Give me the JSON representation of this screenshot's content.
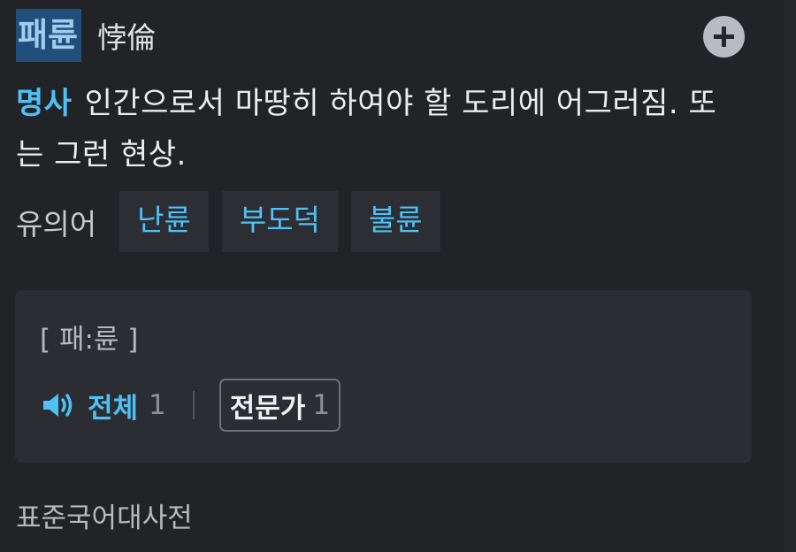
{
  "entry": {
    "headword": "패륜",
    "hanja": "悖倫",
    "add_button_icon": "plus-icon"
  },
  "definition": {
    "pos": "명사",
    "text": "인간으로서 마땅히 하여야 할 도리에 어그러짐. 또는 그런 현상."
  },
  "synonyms": {
    "label": "유의어",
    "items": [
      "난륜",
      "부도덕",
      "불륜"
    ]
  },
  "pronunciation": {
    "text": "[ 패:륜 ]",
    "all_label": "전체",
    "all_count": "1",
    "expert_label": "전문가",
    "expert_count": "1",
    "speaker_icon": "speaker-icon"
  },
  "source": "표준국어대사전",
  "colors": {
    "accent": "#4ec1f5",
    "background": "#222327",
    "card": "#2c2d32",
    "highlight": "#214f7b"
  }
}
